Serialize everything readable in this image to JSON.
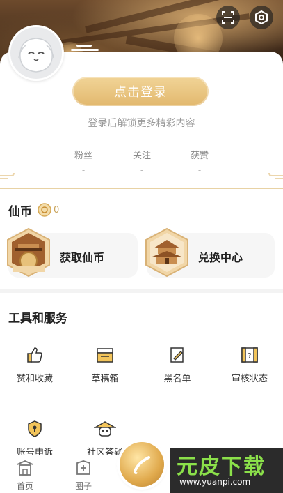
{
  "header": {
    "scan_icon": "scan-icon",
    "settings_icon": "settings-icon"
  },
  "profile": {
    "login_button": "点击登录",
    "hint": "登录后解锁更多精彩内容",
    "stats": [
      {
        "label": "粉丝",
        "value": "-"
      },
      {
        "label": "关注",
        "value": "-"
      },
      {
        "label": "获赞",
        "value": "-"
      }
    ]
  },
  "coins": {
    "title": "仙币",
    "balance": "0",
    "cards": [
      {
        "label": "获取仙币",
        "icon": "coin-pagoda-icon"
      },
      {
        "label": "兑换中心",
        "icon": "pagoda-icon"
      }
    ]
  },
  "tools": {
    "title": "工具和服务",
    "items": [
      {
        "label": "赞和收藏",
        "icon": "thumbs-up-icon"
      },
      {
        "label": "草稿箱",
        "icon": "drafts-box-icon"
      },
      {
        "label": "黑名单",
        "icon": "blacklist-icon"
      },
      {
        "label": "审核状态",
        "icon": "review-status-icon"
      },
      {
        "label": "账号申诉",
        "icon": "account-appeal-icon"
      },
      {
        "label": "社区答疑",
        "icon": "community-qa-icon"
      }
    ]
  },
  "nav": {
    "items": [
      {
        "label": "首页",
        "icon": "home-icon"
      },
      {
        "label": "圈子",
        "icon": "circle-icon"
      }
    ]
  },
  "watermark": {
    "title": "元皮下载",
    "url": "www.yuanpi.com"
  },
  "colors": {
    "accent_gold": "#e2b86e",
    "coin_text": "#c9a45c",
    "watermark_green": "#8be04a"
  }
}
